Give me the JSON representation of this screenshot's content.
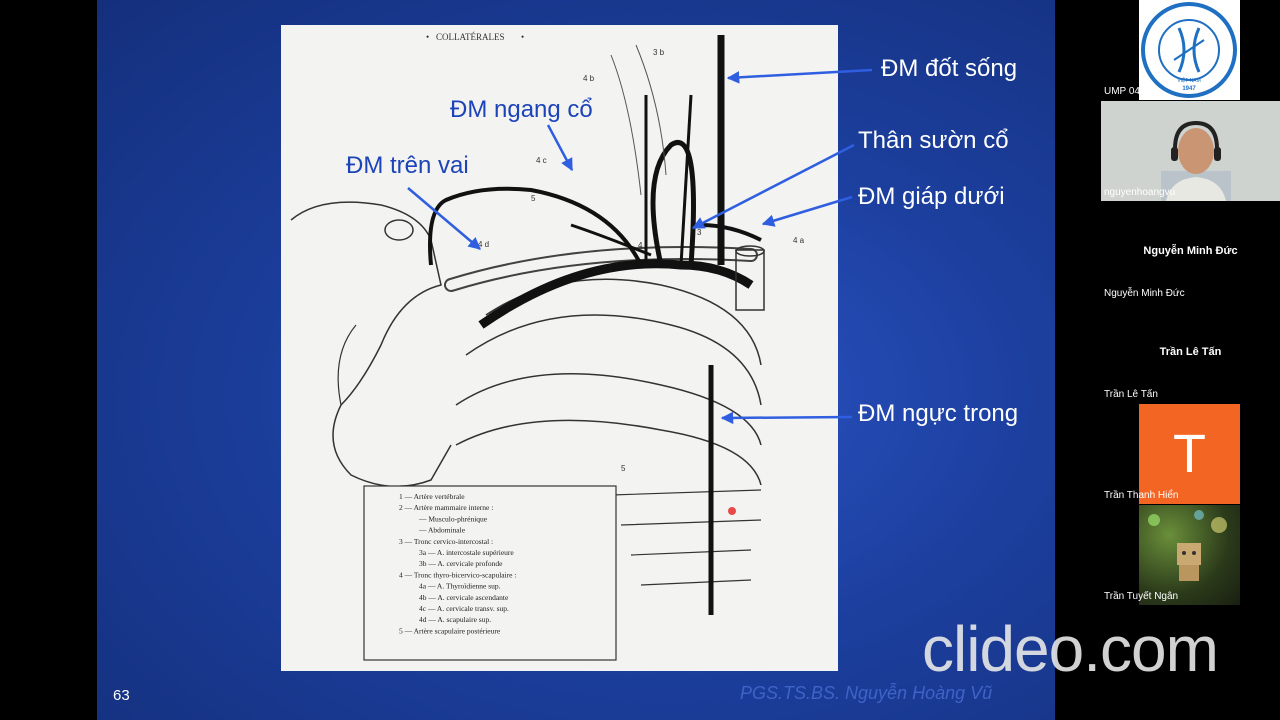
{
  "slide": {
    "number": "63",
    "author": "PGS.TS.BS. Nguyễn Hoàng Vũ",
    "diagram_title": "COLLATÉRALES",
    "labels": {
      "vertebral": "ĐM đốt sống",
      "transverse_cervical": "ĐM ngang cổ",
      "costocervical": "Thân sườn cổ",
      "suprascapular": "ĐM trên vai",
      "inferior_thyroid": "ĐM giáp dưới",
      "internal_thoracic": "ĐM ngực trong"
    },
    "figure_numbers": [
      "3 b",
      "4 b",
      "4 c",
      "5",
      "4 d",
      "4",
      "3",
      "4 a",
      "5"
    ],
    "legend": [
      "1 — Artère vertébrale",
      "2 — Artère mammaire interne :",
      "— Musculo-phrénique",
      "— Abdominale",
      "3 — Tronc cervico-intercostal :",
      "3a — A. intercostale supérieure",
      "3b — A. cervicale profonde",
      "4 — Tronc thyro-bicervico-scapulaire :",
      "4a — A. Thyroïdienne sup.",
      "4b — A. cervicale ascendante",
      "4c — A. cervicale transv. sup.",
      "4d — A. scapulaire sup.",
      "5 — Artère scapulaire postérieure"
    ]
  },
  "watermark": "clideo.com",
  "participants": [
    {
      "name": "UMP 04",
      "type": "logo",
      "logo_text": "ĐẠI HỌC Y DƯỢC THÀNH PHỐ HỒ CHÍ MINH",
      "logo_sub": "VIỆT NAM",
      "logo_year": "1947"
    },
    {
      "name": "nguyenhoangvu",
      "type": "video"
    },
    {
      "name": "Nguyễn Minh Đức",
      "type": "text",
      "display": "Nguyễn Minh Đức"
    },
    {
      "name": "Trần Lê Tấn",
      "type": "text",
      "display": "Trần Lê Tấn"
    },
    {
      "name": "Trần Thanh Hiển",
      "type": "avatar",
      "initial": "T",
      "color": "#f26522"
    },
    {
      "name": "Trần Tuyết Ngân",
      "type": "image"
    }
  ]
}
